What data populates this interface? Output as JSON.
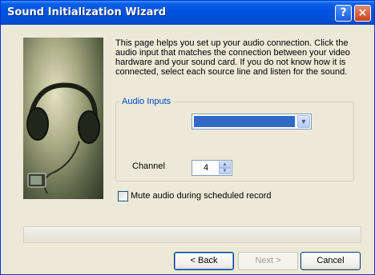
{
  "window": {
    "title": "Sound Initialization Wizard",
    "help_button": "?",
    "close_button": "×"
  },
  "intro_text": "This page helps you set up your audio connection. Click the audio input that matches the connection between your video hardware and your sound card. If you do not know how it is connected, select each source line and listen for the sound.",
  "audio_inputs": {
    "group_label": "Audio Inputs",
    "selected_value": "",
    "dropdown_icon": "chevron-down-icon",
    "channel_label": "Channel",
    "channel_value": "4"
  },
  "mute_checkbox": {
    "label": "Mute audio during scheduled record",
    "checked": false
  },
  "buttons": {
    "back": "< Back",
    "next": "Next >",
    "cancel": "Cancel"
  },
  "colors": {
    "titlebar": "#0053e1",
    "selection": "#316ac5",
    "group_label": "#0046d5"
  }
}
